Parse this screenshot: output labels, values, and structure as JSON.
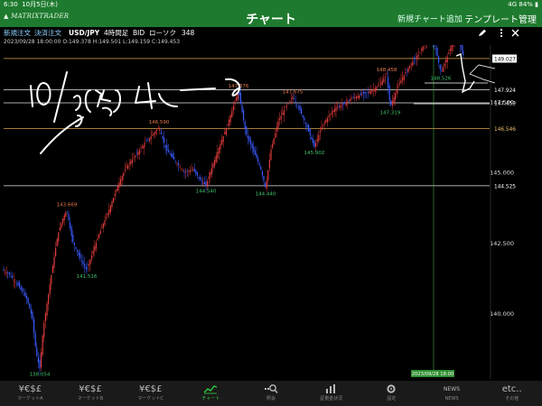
{
  "status": {
    "time": "6:30",
    "date": "10月5日(木)",
    "signal": "4G",
    "battery": "84%"
  },
  "header": {
    "brand": "MATRIXTRADER",
    "title": "チャート",
    "add_chart": "新規チャート追加",
    "template": "テンプレート管理"
  },
  "toolbar": {
    "new_order": "新規注文",
    "settle_order": "決済注文",
    "pair": "USD/JPY",
    "interval": "4時間足",
    "side": "BID",
    "candle": "ローソク",
    "count": "348"
  },
  "ohlc": "2023/09/28 18:00:00  O:149.378  H:149.501  L:149.159  C:149.453",
  "nav": [
    {
      "icon": "¥€$£",
      "label": "マーケットA",
      "active": false
    },
    {
      "icon": "¥€$£",
      "label": "マーケットB",
      "active": false
    },
    {
      "icon": "¥€$£",
      "label": "マーケットC",
      "active": false
    },
    {
      "icon": "chart",
      "label": "チャート",
      "active": true
    },
    {
      "icon": "search",
      "label": "照会",
      "active": false
    },
    {
      "icon": "bars",
      "label": "証拠金状況",
      "active": false
    },
    {
      "icon": "gear",
      "label": "設定",
      "active": false
    },
    {
      "icon": "news",
      "label": "NEWS",
      "active": false
    },
    {
      "icon": "etc",
      "label": "その他",
      "active": false
    }
  ],
  "nav_icon_text": {
    "etc": "etc..",
    "news": "NEWS"
  },
  "chart_data": {
    "type": "candlestick",
    "instrument": "USD/JPY",
    "interval": "4時間足",
    "ylim": [
      137.8,
      150.25
    ],
    "yticks": [
      140.0,
      142.5,
      145.0,
      147.5,
      150.0
    ],
    "price_tags": [
      {
        "value": 150.153,
        "style": "current"
      },
      {
        "value": 149.663,
        "style": "line"
      },
      {
        "value": 149.027,
        "style": "marker"
      },
      {
        "value": 147.924,
        "style": "line"
      },
      {
        "value": 147.459,
        "style": "line"
      },
      {
        "value": 146.546,
        "style": "orange"
      },
      {
        "value": 144.525,
        "style": "line"
      }
    ],
    "annotations": [
      {
        "text": "143.669",
        "value": 143.669,
        "color": "#e87a4a"
      },
      {
        "text": "141.516",
        "value": 141.516,
        "color": "#3ec46d"
      },
      {
        "text": "138.054",
        "value": 138.054,
        "color": "#3ec46d"
      },
      {
        "text": "146.590",
        "value": 146.59,
        "color": "#e87a4a"
      },
      {
        "text": "144.540",
        "value": 144.54,
        "color": "#3ec46d"
      },
      {
        "text": "147.876",
        "value": 147.876,
        "color": "#e87a4a"
      },
      {
        "text": "144.440",
        "value": 144.44,
        "color": "#3ec46d"
      },
      {
        "text": "147.675",
        "value": 147.675,
        "color": "#e87a4a"
      },
      {
        "text": "145.902",
        "value": 145.902,
        "color": "#3ec46d"
      },
      {
        "text": "148.458",
        "value": 148.458,
        "color": "#e87a4a"
      },
      {
        "text": "147.319",
        "value": 147.319,
        "color": "#3ec46d"
      },
      {
        "text": "149.707",
        "value": 149.707,
        "color": "#e87a4a"
      },
      {
        "text": "148.526",
        "value": 148.526,
        "color": "#3ec46d"
      }
    ],
    "crosshair_label": "2023/09/28 18:00",
    "handwriting": "10/5(木) 4h ー b",
    "path": [
      [
        0,
        141.6
      ],
      [
        10,
        141.4
      ],
      [
        20,
        141.0
      ],
      [
        30,
        140.5
      ],
      [
        36,
        139.8
      ],
      [
        40,
        138.6
      ],
      [
        44,
        138.05
      ],
      [
        48,
        139.5
      ],
      [
        56,
        141.2
      ],
      [
        64,
        142.8
      ],
      [
        70,
        143.4
      ],
      [
        74,
        143.67
      ],
      [
        80,
        142.6
      ],
      [
        88,
        142.0
      ],
      [
        96,
        141.52
      ],
      [
        104,
        142.3
      ],
      [
        112,
        143.0
      ],
      [
        120,
        143.6
      ],
      [
        130,
        144.5
      ],
      [
        140,
        145.2
      ],
      [
        150,
        145.6
      ],
      [
        160,
        146.0
      ],
      [
        168,
        146.3
      ],
      [
        176,
        146.59
      ],
      [
        184,
        145.8
      ],
      [
        194,
        145.4
      ],
      [
        204,
        145.0
      ],
      [
        214,
        145.1
      ],
      [
        222,
        144.7
      ],
      [
        228,
        144.54
      ],
      [
        236,
        145.3
      ],
      [
        244,
        146.0
      ],
      [
        252,
        146.7
      ],
      [
        258,
        147.3
      ],
      [
        264,
        147.88
      ],
      [
        272,
        146.4
      ],
      [
        280,
        145.8
      ],
      [
        288,
        145.2
      ],
      [
        294,
        144.44
      ],
      [
        300,
        145.8
      ],
      [
        308,
        146.8
      ],
      [
        316,
        147.3
      ],
      [
        324,
        147.68
      ],
      [
        332,
        147.2
      ],
      [
        340,
        146.6
      ],
      [
        348,
        145.9
      ],
      [
        356,
        146.6
      ],
      [
        364,
        147.0
      ],
      [
        372,
        147.3
      ],
      [
        380,
        147.4
      ],
      [
        388,
        147.6
      ],
      [
        396,
        147.7
      ],
      [
        404,
        147.8
      ],
      [
        412,
        147.9
      ],
      [
        420,
        148.1
      ],
      [
        428,
        148.46
      ],
      [
        432,
        147.32
      ],
      [
        440,
        148.0
      ],
      [
        448,
        148.5
      ],
      [
        456,
        148.9
      ],
      [
        464,
        149.2
      ],
      [
        470,
        149.6
      ],
      [
        476,
        149.71
      ],
      [
        482,
        149.4
      ],
      [
        488,
        148.53
      ],
      [
        494,
        149.0
      ],
      [
        500,
        149.5
      ],
      [
        505,
        149.8
      ],
      [
        510,
        149.45
      ],
      [
        514,
        149.03
      ]
    ]
  }
}
